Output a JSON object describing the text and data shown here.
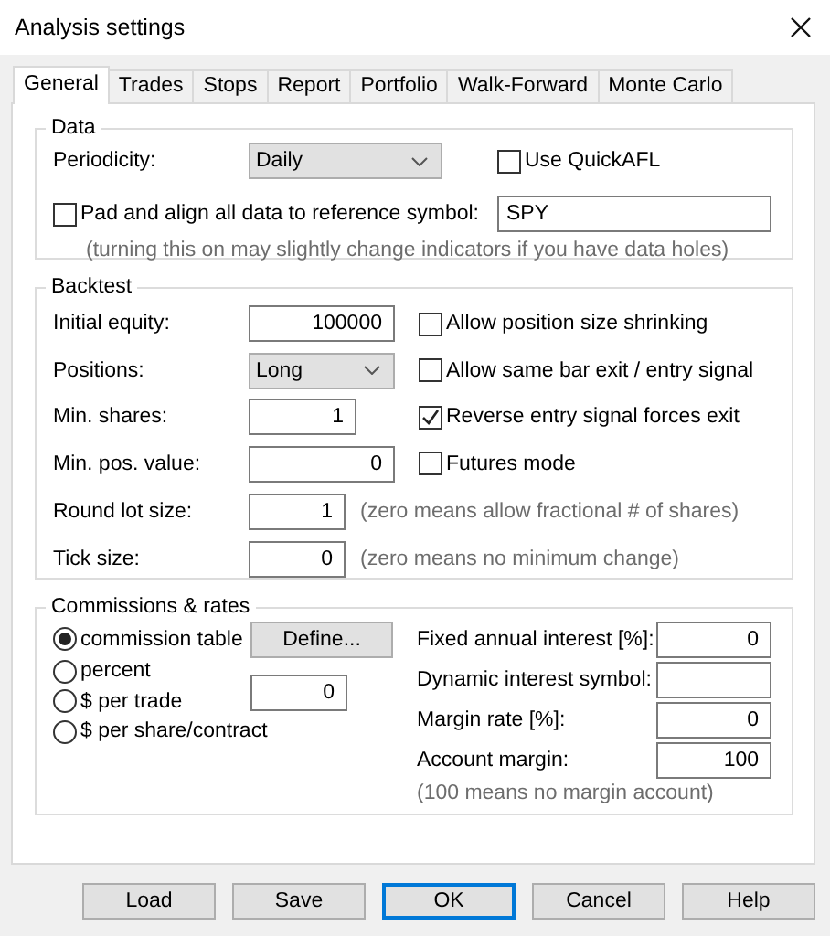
{
  "window": {
    "title": "Analysis settings"
  },
  "tabs": [
    {
      "label": "General",
      "selected": true
    },
    {
      "label": "Trades",
      "selected": false
    },
    {
      "label": "Stops",
      "selected": false
    },
    {
      "label": "Report",
      "selected": false
    },
    {
      "label": "Portfolio",
      "selected": false
    },
    {
      "label": "Walk-Forward",
      "selected": false
    },
    {
      "label": "Monte Carlo",
      "selected": false
    }
  ],
  "data_group": {
    "title": "Data",
    "periodicity_label": "Periodicity:",
    "periodicity_value": "Daily",
    "use_quickafl": {
      "label": "Use QuickAFL",
      "checked": false
    },
    "pad_align": {
      "label": "Pad and align all data to reference symbol:",
      "checked": false
    },
    "reference_symbol": "SPY",
    "note": "(turning this on may slightly change indicators if you have data holes)"
  },
  "backtest_group": {
    "title": "Backtest",
    "rows": [
      {
        "label": "Initial equity:",
        "control": {
          "kind": "field",
          "value": "100000"
        },
        "extra": {
          "kind": "checkbox",
          "label": "Allow position size shrinking",
          "checked": false
        }
      },
      {
        "label": "Positions:",
        "control": {
          "kind": "dropdown",
          "value": "Long"
        },
        "extra": {
          "kind": "checkbox",
          "label": "Allow same bar exit / entry signal",
          "checked": false
        }
      },
      {
        "label": "Min. shares:",
        "control": {
          "kind": "field",
          "value": "1"
        },
        "extra": {
          "kind": "checkbox",
          "label": "Reverse entry signal forces exit",
          "checked": true
        }
      },
      {
        "label": "Min. pos. value:",
        "control": {
          "kind": "field",
          "value": "0"
        },
        "extra": {
          "kind": "checkbox",
          "label": "Futures mode",
          "checked": false
        }
      },
      {
        "label": "Round lot size:",
        "control": {
          "kind": "field",
          "value": "1"
        },
        "extra": {
          "kind": "note",
          "text": "(zero means allow fractional # of shares)"
        }
      },
      {
        "label": "Tick size:",
        "control": {
          "kind": "field",
          "value": "0"
        },
        "extra": {
          "kind": "note",
          "text": "(zero means no minimum change)"
        }
      }
    ]
  },
  "commissions_group": {
    "title": "Commissions & rates",
    "options": [
      {
        "label": "commission table",
        "selected": true
      },
      {
        "label": "percent",
        "selected": false
      },
      {
        "label": "$ per trade",
        "selected": false
      },
      {
        "label": "$ per share/contract",
        "selected": false
      }
    ],
    "define_button": "Define...",
    "commission_value": "0",
    "rates": [
      {
        "label": "Fixed annual interest [%]:",
        "value": "0"
      },
      {
        "label": "Dynamic interest symbol:"
      },
      {
        "label": "Margin rate [%]:",
        "value": "0"
      },
      {
        "label": "Account margin:",
        "value": "100"
      }
    ],
    "note": "(100 means no margin account)"
  },
  "buttons": [
    {
      "label": "Load",
      "default": false
    },
    {
      "label": "Save",
      "default": false
    },
    {
      "label": "OK",
      "default": true
    },
    {
      "label": "Cancel",
      "default": false
    },
    {
      "label": "Help",
      "default": false
    }
  ]
}
